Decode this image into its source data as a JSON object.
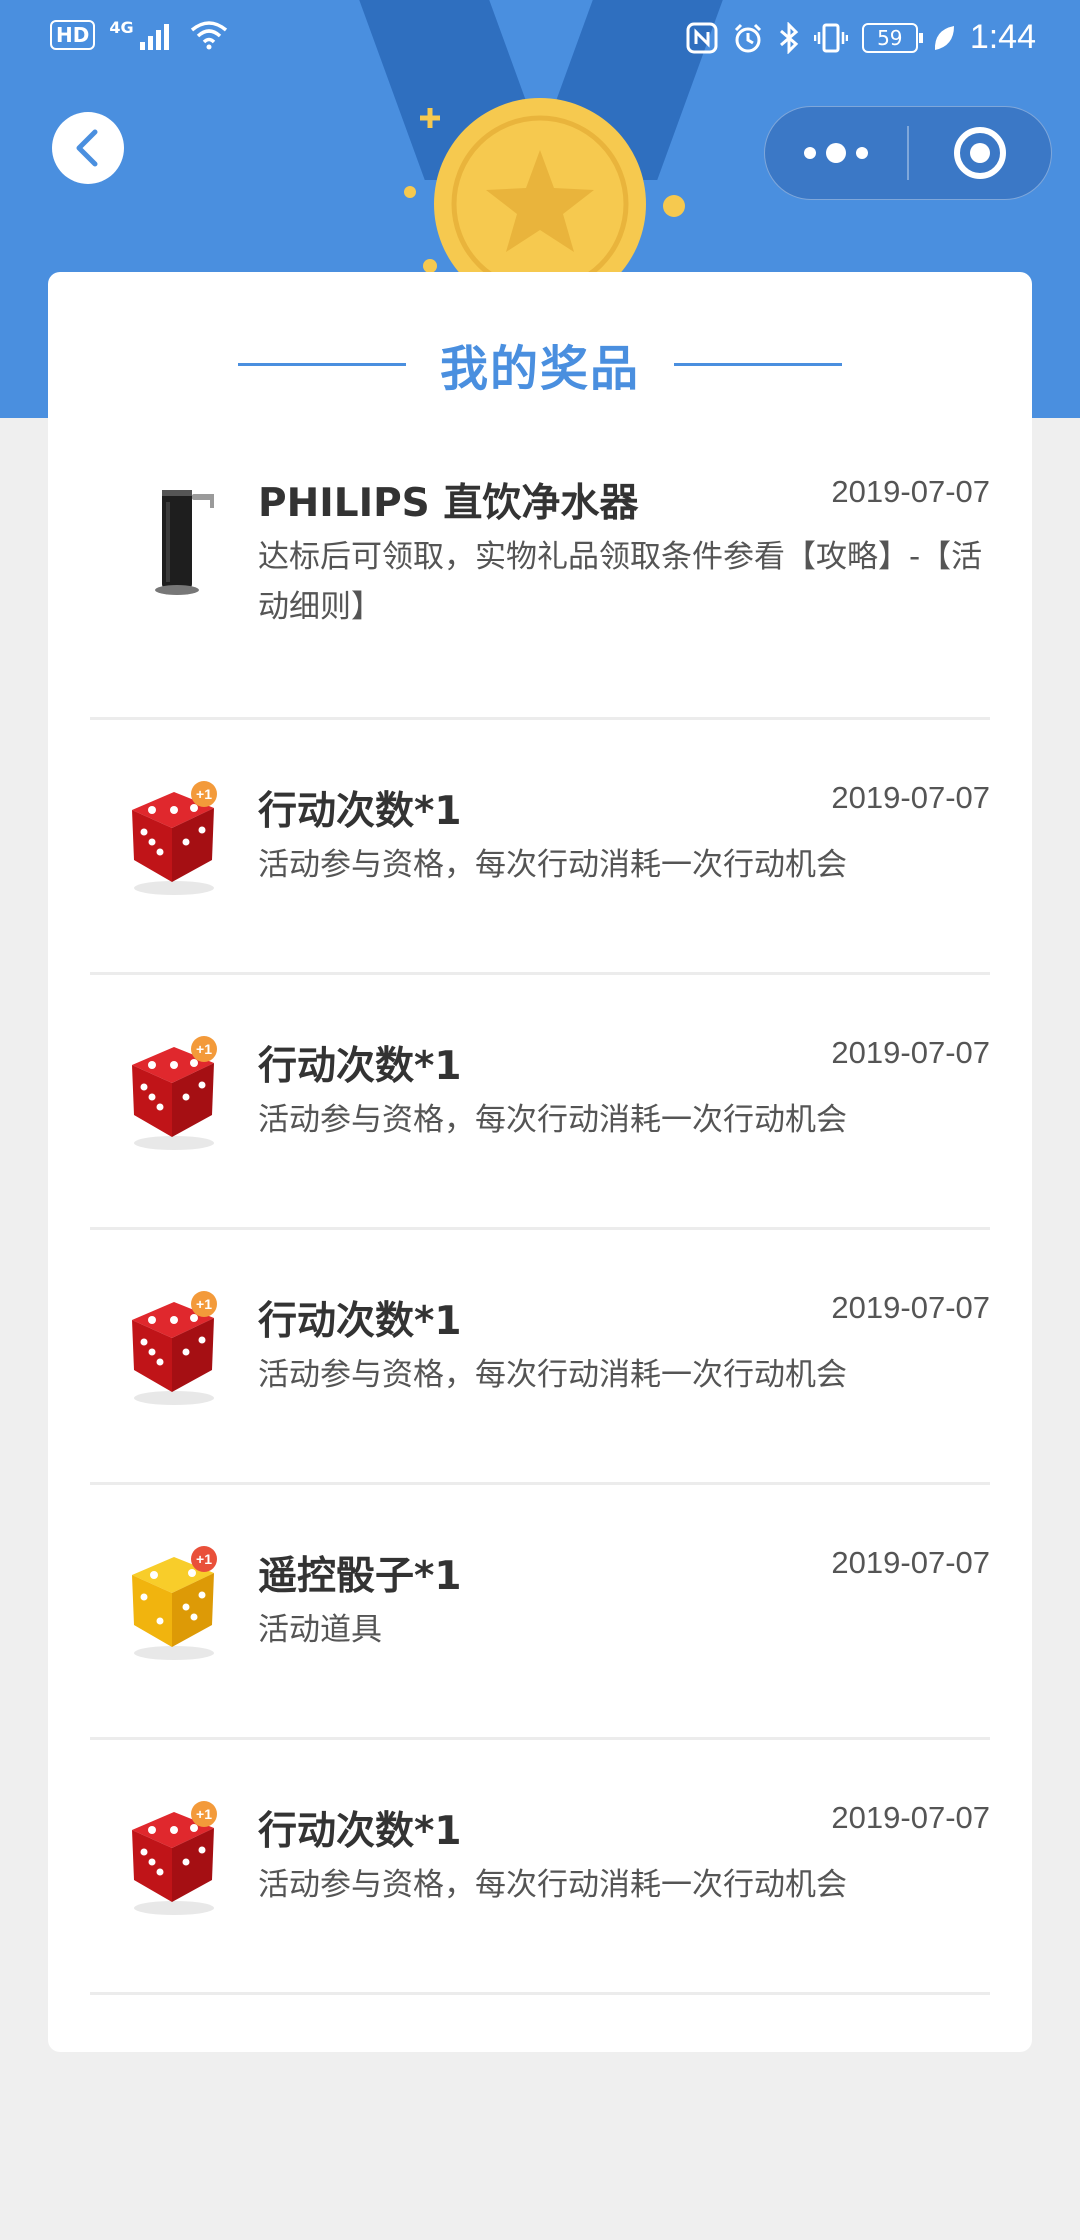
{
  "status_bar": {
    "hd": "HD",
    "network": "4G",
    "battery": "59",
    "time": "1:44"
  },
  "nav": {
    "back_icon": "chevron-left-icon",
    "more_icon": "more-dots-icon",
    "close_icon": "target-circle-icon"
  },
  "colors": {
    "header_blue": "#4a8fdf",
    "title_blue": "#4a8fdf",
    "medal_gold": "#f6c94f",
    "dice_red": "#d0161b",
    "dice_yellow": "#f1b40e"
  },
  "card": {
    "title": "我的奖品"
  },
  "prizes": [
    {
      "name": "PHILIPS 直饮净水器",
      "date": "2019-07-07",
      "desc": "达标后可领取，实物礼品领取条件参看【攻略】-【活动细则】",
      "icon": "water-purifier-icon"
    },
    {
      "name": "行动次数*1",
      "date": "2019-07-07",
      "desc": "活动参与资格，每次行动消耗一次行动机会",
      "icon": "red-dice-icon",
      "badge": "+1"
    },
    {
      "name": "行动次数*1",
      "date": "2019-07-07",
      "desc": "活动参与资格，每次行动消耗一次行动机会",
      "icon": "red-dice-icon",
      "badge": "+1"
    },
    {
      "name": "行动次数*1",
      "date": "2019-07-07",
      "desc": "活动参与资格，每次行动消耗一次行动机会",
      "icon": "red-dice-icon",
      "badge": "+1"
    },
    {
      "name": "遥控骰子*1",
      "date": "2019-07-07",
      "desc": "活动道具",
      "icon": "yellow-dice-icon",
      "badge": "+1"
    },
    {
      "name": "行动次数*1",
      "date": "2019-07-07",
      "desc": "活动参与资格，每次行动消耗一次行动机会",
      "icon": "red-dice-icon",
      "badge": "+1"
    }
  ]
}
